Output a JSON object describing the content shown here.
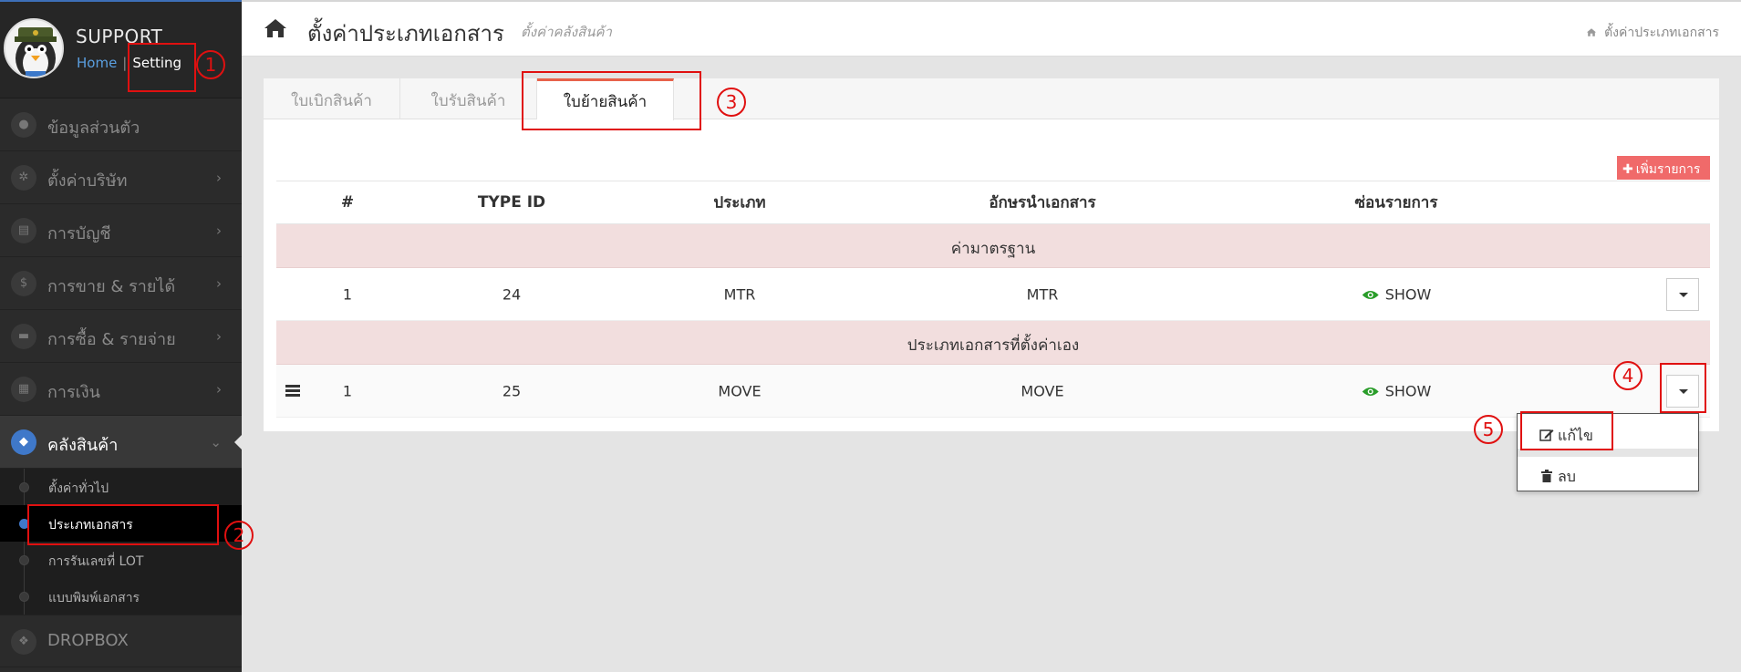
{
  "sidebar": {
    "profile_name": "SUPPORT",
    "home_link": "Home",
    "setting_link": "Setting",
    "menu": [
      {
        "label": "ข้อมูลส่วนตัว",
        "icon": "user-icon",
        "glyph": "●",
        "has_chevron": false
      },
      {
        "label": "ตั้งค่าบริษัท",
        "icon": "gear-icon",
        "glyph": "✲",
        "has_chevron": true
      },
      {
        "label": "การบัญชี",
        "icon": "book-icon",
        "glyph": "▤",
        "has_chevron": true
      },
      {
        "label": "การขาย & รายได้",
        "icon": "dollar-icon",
        "glyph": "$",
        "has_chevron": true
      },
      {
        "label": "การซื้อ & รายจ่าย",
        "icon": "cart-icon",
        "glyph": "▬",
        "has_chevron": true
      },
      {
        "label": "การเงิน",
        "icon": "calendar-icon",
        "glyph": "▦",
        "has_chevron": true
      }
    ],
    "active_menu": {
      "label": "คลังสินค้า",
      "icon": "cube-icon",
      "glyph": "◆"
    },
    "submenu": [
      {
        "label": "ตั้งค่าทั่วไป",
        "selected": false
      },
      {
        "label": "ประเภทเอกสาร",
        "selected": true
      },
      {
        "label": "การรันเลขที่ LOT",
        "selected": false
      },
      {
        "label": "แบบพิมพ์เอกสาร",
        "selected": false
      }
    ],
    "bottom_menu": {
      "label": "DROPBOX",
      "icon": "dropbox-icon",
      "glyph": "❖"
    }
  },
  "header": {
    "title": "ตั้งค่าประเภทเอกสาร",
    "subtitle": "ตั้งค่าคลังสินค้า",
    "breadcrumb": "ตั้งค่าประเภทเอกสาร"
  },
  "tabs": [
    "ใบเบิกสินค้า",
    "ใบรับสินค้า",
    "ใบย้ายสินค้า"
  ],
  "active_tab": 2,
  "add_button": "เพิ่มรายการ",
  "table": {
    "columns": [
      "#",
      "TYPE ID",
      "ประเภท",
      "อักษรนำเอกสาร",
      "ซ่อนรายการ"
    ],
    "groups": [
      {
        "title": "ค่ามาตรฐาน",
        "rows": [
          {
            "num": "1",
            "type_id": "24",
            "type": "MTR",
            "prefix": "MTR",
            "visibility": "SHOW"
          }
        ]
      },
      {
        "title": "ประเภทเอกสารที่ตั้งค่าเอง",
        "rows": [
          {
            "num": "1",
            "type_id": "25",
            "type": "MOVE",
            "prefix": "MOVE",
            "visibility": "SHOW"
          }
        ]
      }
    ]
  },
  "dropdown": {
    "edit": "แก้ไข",
    "delete": "ลบ"
  },
  "annotations": [
    "1",
    "2",
    "3",
    "4",
    "5"
  ],
  "colors": {
    "sidebar_bg": "#2b2b2b",
    "accent_blue": "#3f78c9",
    "tab_accent": "#e8624b",
    "group_row": "#f2dede",
    "add_button": "#f06a6a",
    "show_icon": "#2a9d2a",
    "annotation_red": "#e01010"
  }
}
